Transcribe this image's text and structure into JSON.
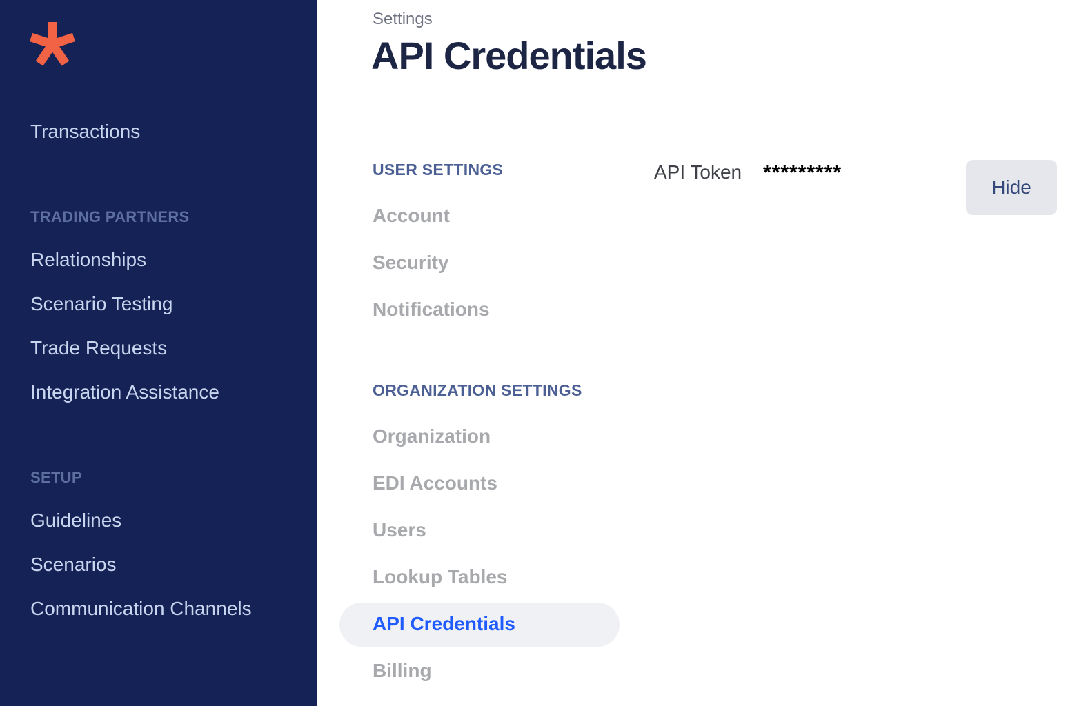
{
  "colors": {
    "sidebar_bg": "#142255",
    "brand_accent": "#f26244",
    "active_link": "#1f5bff",
    "active_pill_bg": "#f0f1f5"
  },
  "sidebar": {
    "logo_icon": "asterisk-logo-icon",
    "top_items": [
      {
        "label": "Transactions"
      }
    ],
    "sections": [
      {
        "title": "TRADING PARTNERS",
        "items": [
          {
            "label": "Relationships"
          },
          {
            "label": "Scenario Testing"
          },
          {
            "label": "Trade Requests"
          },
          {
            "label": "Integration Assistance"
          }
        ]
      },
      {
        "title": "SETUP",
        "items": [
          {
            "label": "Guidelines"
          },
          {
            "label": "Scenarios"
          },
          {
            "label": "Communication Channels"
          }
        ]
      }
    ]
  },
  "header": {
    "breadcrumb": "Settings",
    "title": "API Credentials"
  },
  "settings_nav": {
    "user_settings": {
      "title": "USER SETTINGS",
      "items": [
        {
          "label": "Account"
        },
        {
          "label": "Security"
        },
        {
          "label": "Notifications"
        }
      ]
    },
    "organization_settings": {
      "title": "ORGANIZATION SETTINGS",
      "items": [
        {
          "label": "Organization"
        },
        {
          "label": "EDI Accounts"
        },
        {
          "label": "Users"
        },
        {
          "label": "Lookup Tables"
        },
        {
          "label": "API Credentials",
          "active": true
        },
        {
          "label": "Billing"
        }
      ]
    }
  },
  "credentials": {
    "token_label": "API Token",
    "token_value": "*********",
    "hide_label": "Hide"
  }
}
